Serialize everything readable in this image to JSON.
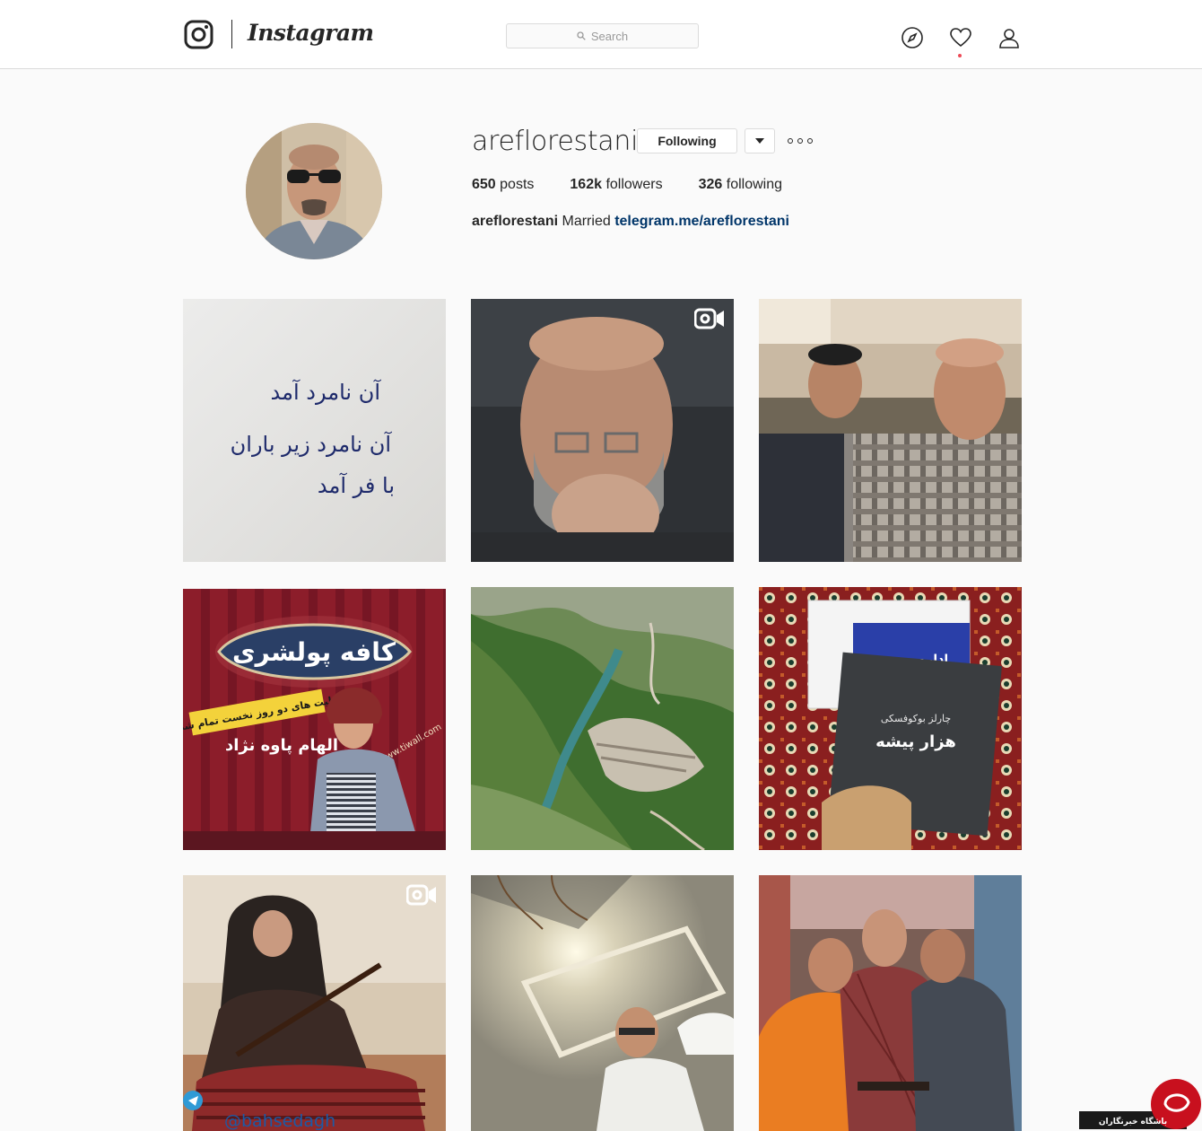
{
  "nav": {
    "brand": "Instagram",
    "search_placeholder": "Search"
  },
  "profile": {
    "username": "areflorestani",
    "follow_label": "Following",
    "stats": {
      "posts_count": "650",
      "posts_label": "posts",
      "followers_count": "162k",
      "followers_label": "followers",
      "following_count": "326",
      "following_label": "following"
    },
    "bio": {
      "name": "areflorestani",
      "text": "Married",
      "link": "telegram.me/areflorestani"
    }
  },
  "posts": {
    "p1_lines": [
      "آن نامرد آمد",
      "آن نامرد زیر باران",
      "با فر آمد"
    ],
    "p4_title": "کافه پولشری",
    "p4_banner": "بلیت های دو روز نخست تمام شد",
    "p4_actor": "الهام پاوه نژاد",
    "p4_site": "www.tiwall.com",
    "p6_book_top": "اداره پست",
    "p6_book_author": "چارلز بوکوفسکی",
    "p6_book_title": "هزار پیشه",
    "p7_handle": "@bahsedagh"
  },
  "watermark": {
    "text": "باشگاه خبرنگاران"
  },
  "colors": {
    "link": "#003569",
    "border": "#dbdbdb",
    "notification": "#ed4956",
    "badge_red": "#c8101e"
  },
  "icons": [
    "instagram-glyph-icon",
    "search-icon",
    "compass-icon",
    "heart-icon",
    "user-icon",
    "chevron-down-icon",
    "video-icon"
  ]
}
